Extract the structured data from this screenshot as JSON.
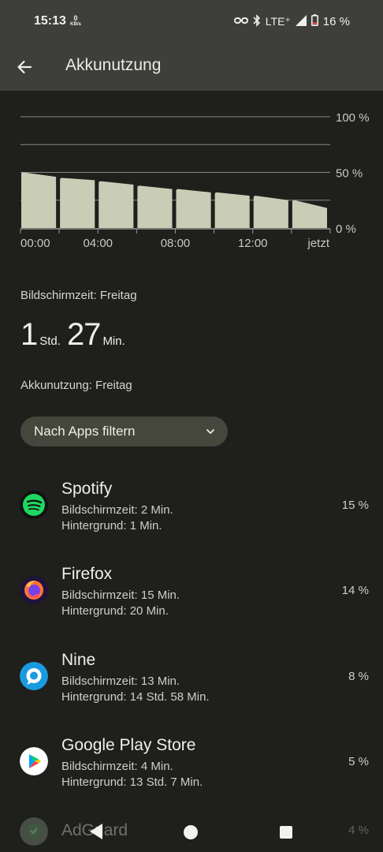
{
  "status_bar": {
    "time": "15:13",
    "net_speed_value": "0",
    "net_speed_unit": "KB/s",
    "network": "LTE⁺",
    "battery_percent": "16 %",
    "icons": [
      "vpn-key-icon",
      "bluetooth-icon",
      "signal-icon",
      "battery-icon"
    ]
  },
  "header": {
    "title": "Akkunutzung"
  },
  "chart_data": {
    "type": "bar",
    "ylim": [
      0,
      100
    ],
    "y_tick_labels": [
      "100 %",
      "50 %",
      "0 %"
    ],
    "x_tick_labels": [
      "00:00",
      "04:00",
      "08:00",
      "12:00",
      "jetzt"
    ],
    "values": [
      [
        50,
        46
      ],
      [
        45,
        43
      ],
      [
        42,
        39
      ],
      [
        38,
        35
      ],
      [
        35,
        32
      ],
      [
        32,
        29
      ],
      [
        29,
        25
      ],
      [
        25,
        18
      ]
    ],
    "bar_color": "#c9cdb6",
    "grid": true
  },
  "screen_time": {
    "label": "Bildschirmzeit: Freitag",
    "hours": "1",
    "hours_unit": "Std.",
    "minutes": "27",
    "minutes_unit": "Min."
  },
  "battery_usage": {
    "label": "Akkunutzung: Freitag"
  },
  "filter": {
    "label": "Nach Apps filtern"
  },
  "apps": [
    {
      "name": "Spotify",
      "screen": "Bildschirmzeit: 2 Min.",
      "background": "Hintergrund: 1 Min.",
      "percent": "15 %",
      "icon": "spotify-icon"
    },
    {
      "name": "Firefox",
      "screen": "Bildschirmzeit: 15 Min.",
      "background": "Hintergrund: 20 Min.",
      "percent": "14 %",
      "icon": "firefox-icon"
    },
    {
      "name": "Nine",
      "screen": "Bildschirmzeit: 13 Min.",
      "background": "Hintergrund: 14 Std. 58 Min.",
      "percent": "8 %",
      "icon": "nine-icon"
    },
    {
      "name": "Google Play Store",
      "screen": "Bildschirmzeit: 4 Min.",
      "background": "Hintergrund: 13 Std. 7 Min.",
      "percent": "5 %",
      "icon": "play-store-icon"
    },
    {
      "name": "AdGuard",
      "percent": "4 %",
      "icon": "adguard-icon"
    }
  ],
  "colors": {
    "background": "#1f1f1c",
    "topbar": "#3e3e3a",
    "accent": "#c9cdb6",
    "chip": "#45473c"
  }
}
